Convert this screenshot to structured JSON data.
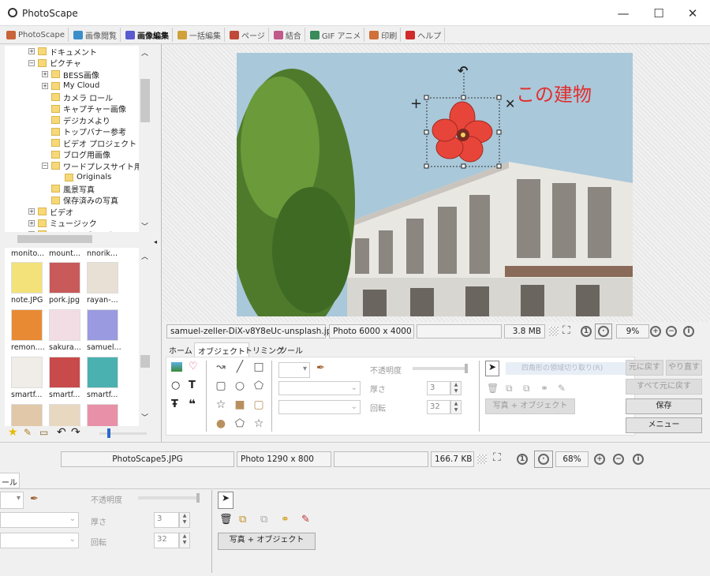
{
  "window": {
    "title": "PhotoScape",
    "controls": [
      "—",
      "☐",
      "✕"
    ]
  },
  "menu_tabs": [
    {
      "label": "PhotoScape",
      "color": "#c9643a"
    },
    {
      "label": "画像閲覧",
      "color": "#3a8ec9"
    },
    {
      "label": "画像編集",
      "color": "#5a5ad0",
      "active": true
    },
    {
      "label": "一括編集",
      "color": "#d0a03a"
    },
    {
      "label": "ページ",
      "color": "#c04a3a"
    },
    {
      "label": "結合",
      "color": "#c05a8a"
    },
    {
      "label": "GIF アニメ",
      "color": "#3a8a5a"
    },
    {
      "label": "印刷",
      "color": "#d0703a"
    },
    {
      "label": "ヘルプ",
      "color": "#d02a2a"
    }
  ],
  "tree": [
    {
      "label": "ドキュメント",
      "level": 1,
      "pm": "+"
    },
    {
      "label": "ピクチャ",
      "level": 1,
      "pm": "−"
    },
    {
      "label": "BESS画像",
      "level": 2,
      "pm": "+"
    },
    {
      "label": "My Cloud",
      "level": 2,
      "pm": "+"
    },
    {
      "label": "カメラ ロール",
      "level": 2
    },
    {
      "label": "キャプチャー画像",
      "level": 2
    },
    {
      "label": "デジカメより",
      "level": 2
    },
    {
      "label": "トップバナー参考",
      "level": 2
    },
    {
      "label": "ビデオ プロジェクト",
      "level": 2
    },
    {
      "label": "ブログ用画像",
      "level": 2
    },
    {
      "label": "ワードプレスサイト用",
      "level": 2,
      "pm": "−"
    },
    {
      "label": "Originals",
      "level": 3
    },
    {
      "label": "風景写真",
      "level": 2
    },
    {
      "label": "保存済みの写真",
      "level": 2
    },
    {
      "label": "ビデオ",
      "level": 1,
      "pm": "+"
    },
    {
      "label": "ミュージック",
      "level": 1,
      "pm": "+"
    },
    {
      "label": "ローカル ディスク (C:)",
      "level": 1,
      "pm": "+"
    }
  ],
  "thumbnails": {
    "header_labels": [
      "monito...",
      "mount...",
      "nnorik..."
    ],
    "rows": [
      [
        {
          "label": "note.JPG",
          "color": "#f3e27a"
        },
        {
          "label": "pork.jpg",
          "color": "#c85a5a"
        },
        {
          "label": "rayan-...",
          "color": "#e8e0d4"
        }
      ],
      [
        {
          "label": "remon....",
          "color": "#e88a34"
        },
        {
          "label": "sakura...",
          "color": "#f3dde4"
        },
        {
          "label": "samuel...",
          "color": "#9a9ae0"
        }
      ],
      [
        {
          "label": "smartf...",
          "color": "#f0ece8"
        },
        {
          "label": "smartf...",
          "color": "#c84a4a"
        },
        {
          "label": "smartf...",
          "color": "#4ab0b0"
        }
      ],
      [
        {
          "label": "",
          "color": "#e0c8a8"
        },
        {
          "label": "",
          "color": "#e8d8c0"
        },
        {
          "label": "",
          "color": "#e890a8"
        }
      ]
    ]
  },
  "canvas": {
    "annotation": "この建物",
    "annotation_color": "#e03030",
    "sky_color": "#a9c8da"
  },
  "status": {
    "filename": "samuel-zeller-DiX-v8Y8eUc-unsplash.jpg",
    "dimensions": "Photo 6000 x 4000",
    "size": "3.8 MB",
    "zoom": "9%"
  },
  "edit_tabs": [
    "ホーム",
    "オブジェクト",
    "トリミング",
    "ツール"
  ],
  "active_edit_tab": 1,
  "object_panel": {
    "opacity_label": "不透明度",
    "thickness_label": "厚さ",
    "thickness": "3",
    "rotation_label": "回転",
    "rotation": "32",
    "photo_object_button": "写真 + オブジェクト",
    "tooltip": "四角形の領域切り取り(R)"
  },
  "actions": {
    "undo": "元に戻す",
    "redo": "やり直す",
    "undo_all": "すべて元に戻す",
    "save": "保存",
    "menu": "メニュー"
  },
  "background_window": {
    "filename": "PhotoScape5.JPG",
    "dimensions": "Photo 1290 x 800",
    "size": "166.7 KB",
    "zoom": "68%",
    "tab_fragment": "ール",
    "opacity_label": "不透明度",
    "thickness_label": "厚さ",
    "thickness": "3",
    "rotation_label": "回転",
    "rotation": "32",
    "photo_object_button": "写真 + オブジェクト"
  }
}
